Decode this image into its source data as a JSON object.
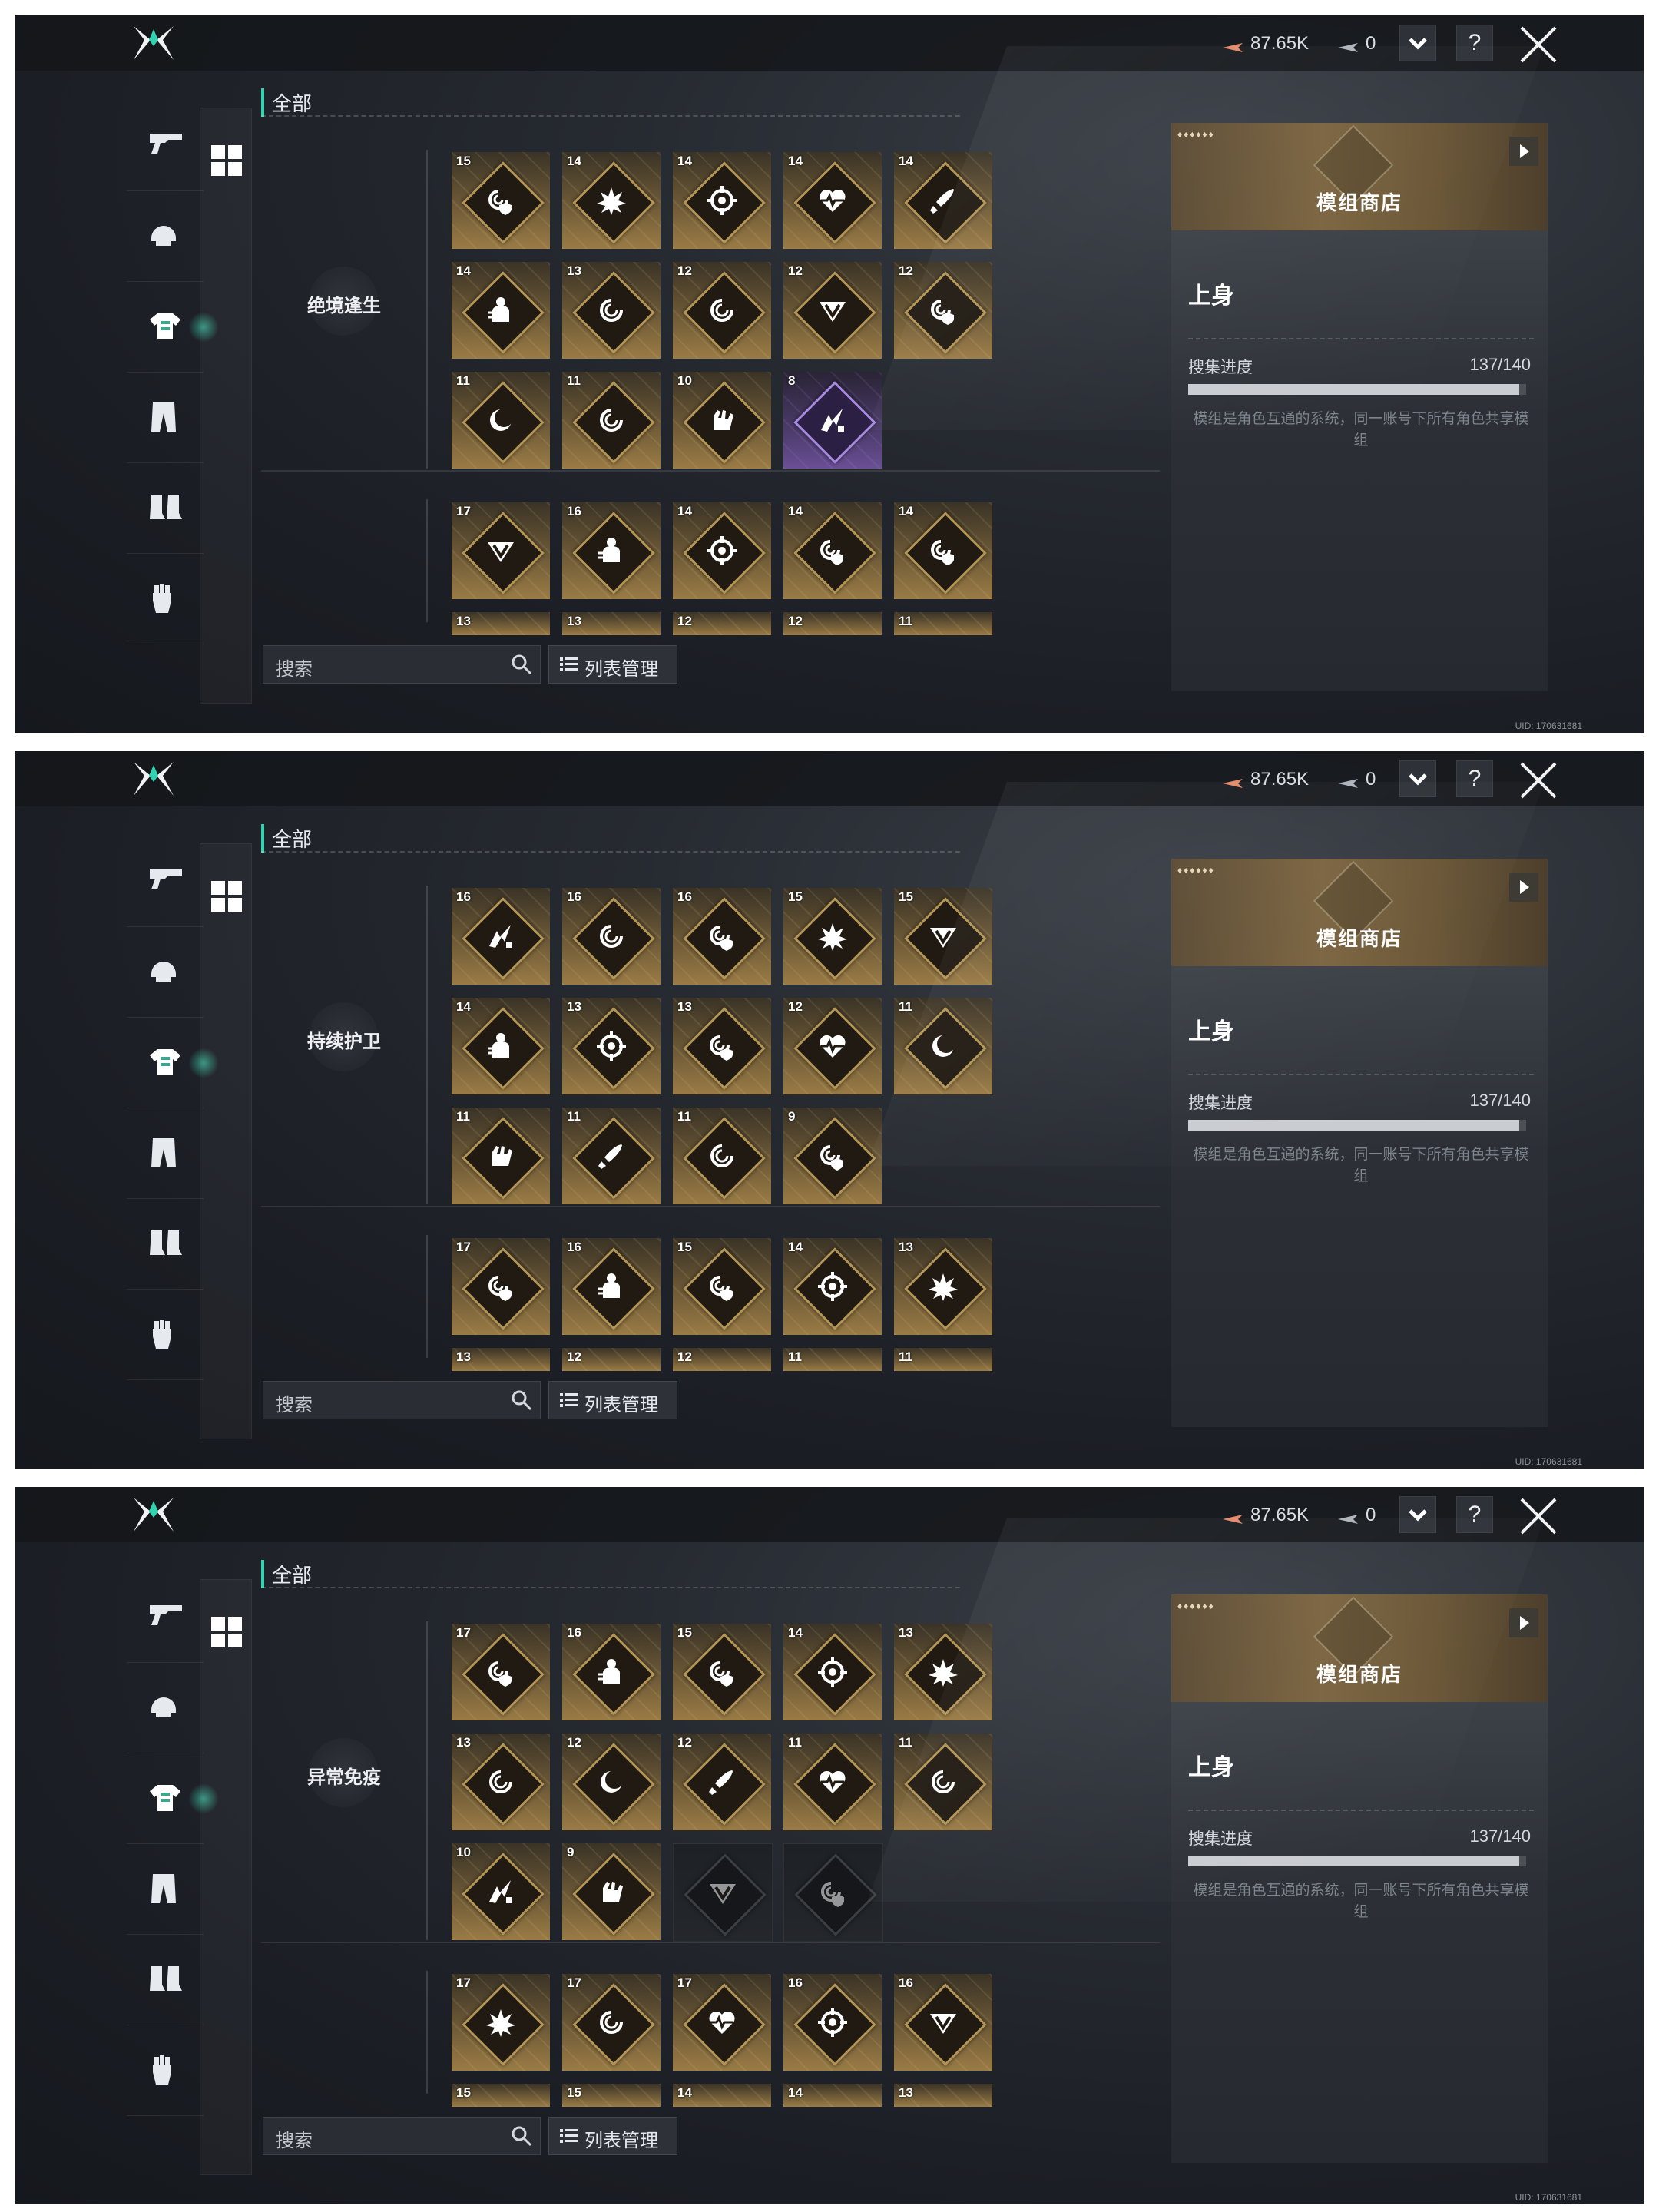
{
  "topbar": {
    "currency1": "87.65K",
    "currency2": "0",
    "dropdown_glyph": "⌄",
    "help_label": "?"
  },
  "nav_icons": [
    "gun-icon",
    "helmet-icon",
    "upper-body-icon",
    "pants-icon",
    "boots-icon",
    "gloves-icon"
  ],
  "filter": {
    "all_label": "全部"
  },
  "search": {
    "placeholder": "搜索"
  },
  "list_manage_label": "列表管理",
  "shop": {
    "title": "模组商店",
    "stars": "♦♦♦♦♦♦"
  },
  "info": {
    "title": "上身",
    "progress_label": "搜集进度",
    "progress_value": "137/140",
    "progress_fraction": 0.979,
    "description": "模组是角色互通的系统，同一账号下所有角色共享模组"
  },
  "uid": "UID: 170631681",
  "accent_color": "#31d3b0",
  "panels": [
    {
      "set_name": "绝境逢生",
      "rows": [
        [
          {
            "lvl": "15",
            "icon": "vortex-shield"
          },
          {
            "lvl": "14",
            "icon": "explosion"
          },
          {
            "lvl": "14",
            "icon": "target"
          },
          {
            "lvl": "14",
            "icon": "heartbeat"
          },
          {
            "lvl": "14",
            "icon": "bullet"
          }
        ],
        [
          {
            "lvl": "14",
            "icon": "person"
          },
          {
            "lvl": "13",
            "icon": "vortex"
          },
          {
            "lvl": "12",
            "icon": "vortex"
          },
          {
            "lvl": "12",
            "icon": "shield-v"
          },
          {
            "lvl": "12",
            "icon": "vortex-shield"
          }
        ],
        [
          {
            "lvl": "11",
            "icon": "crescent"
          },
          {
            "lvl": "11",
            "icon": "vortex"
          },
          {
            "lvl": "10",
            "icon": "hand"
          },
          {
            "lvl": "8",
            "icon": "strike",
            "style": "purple"
          }
        ]
      ],
      "next_row": [
        {
          "lvl": "17",
          "icon": "shield-v"
        },
        {
          "lvl": "16",
          "icon": "person"
        },
        {
          "lvl": "14",
          "icon": "target"
        },
        {
          "lvl": "14",
          "icon": "vortex-shield"
        },
        {
          "lvl": "14",
          "icon": "vortex-shield"
        }
      ],
      "cut_row": [
        "13",
        "13",
        "12",
        "12",
        "11"
      ]
    },
    {
      "set_name": "持续护卫",
      "rows": [
        [
          {
            "lvl": "16",
            "icon": "strike"
          },
          {
            "lvl": "16",
            "icon": "vortex"
          },
          {
            "lvl": "16",
            "icon": "vortex-shield"
          },
          {
            "lvl": "15",
            "icon": "explosion"
          },
          {
            "lvl": "15",
            "icon": "shield-v"
          }
        ],
        [
          {
            "lvl": "14",
            "icon": "person"
          },
          {
            "lvl": "13",
            "icon": "target"
          },
          {
            "lvl": "13",
            "icon": "vortex-shield"
          },
          {
            "lvl": "12",
            "icon": "heartbeat"
          },
          {
            "lvl": "11",
            "icon": "crescent"
          }
        ],
        [
          {
            "lvl": "11",
            "icon": "hand"
          },
          {
            "lvl": "11",
            "icon": "bullet"
          },
          {
            "lvl": "11",
            "icon": "vortex"
          },
          {
            "lvl": "9",
            "icon": "vortex-shield"
          }
        ]
      ],
      "next_row": [
        {
          "lvl": "17",
          "icon": "vortex-shield"
        },
        {
          "lvl": "16",
          "icon": "person"
        },
        {
          "lvl": "15",
          "icon": "vortex-shield"
        },
        {
          "lvl": "14",
          "icon": "target"
        },
        {
          "lvl": "13",
          "icon": "explosion"
        }
      ],
      "cut_row": [
        "13",
        "12",
        "12",
        "11",
        "11"
      ]
    },
    {
      "set_name": "异常免疫",
      "rows": [
        [
          {
            "lvl": "17",
            "icon": "vortex-shield"
          },
          {
            "lvl": "16",
            "icon": "person"
          },
          {
            "lvl": "15",
            "icon": "vortex-shield"
          },
          {
            "lvl": "14",
            "icon": "target"
          },
          {
            "lvl": "13",
            "icon": "explosion"
          }
        ],
        [
          {
            "lvl": "13",
            "icon": "vortex"
          },
          {
            "lvl": "12",
            "icon": "crescent"
          },
          {
            "lvl": "12",
            "icon": "bullet"
          },
          {
            "lvl": "11",
            "icon": "heartbeat"
          },
          {
            "lvl": "11",
            "icon": "vortex"
          }
        ],
        [
          {
            "lvl": "10",
            "icon": "strike"
          },
          {
            "lvl": "9",
            "icon": "hand"
          },
          {
            "lvl": "",
            "icon": "shield-v",
            "style": "dark"
          },
          {
            "lvl": "",
            "icon": "vortex-shield",
            "style": "dark"
          }
        ]
      ],
      "next_row": [
        {
          "lvl": "17",
          "icon": "explosion"
        },
        {
          "lvl": "17",
          "icon": "vortex"
        },
        {
          "lvl": "17",
          "icon": "heartbeat"
        },
        {
          "lvl": "16",
          "icon": "target"
        },
        {
          "lvl": "16",
          "icon": "shield-v"
        }
      ],
      "cut_row": [
        "15",
        "15",
        "14",
        "14",
        "13"
      ]
    }
  ]
}
